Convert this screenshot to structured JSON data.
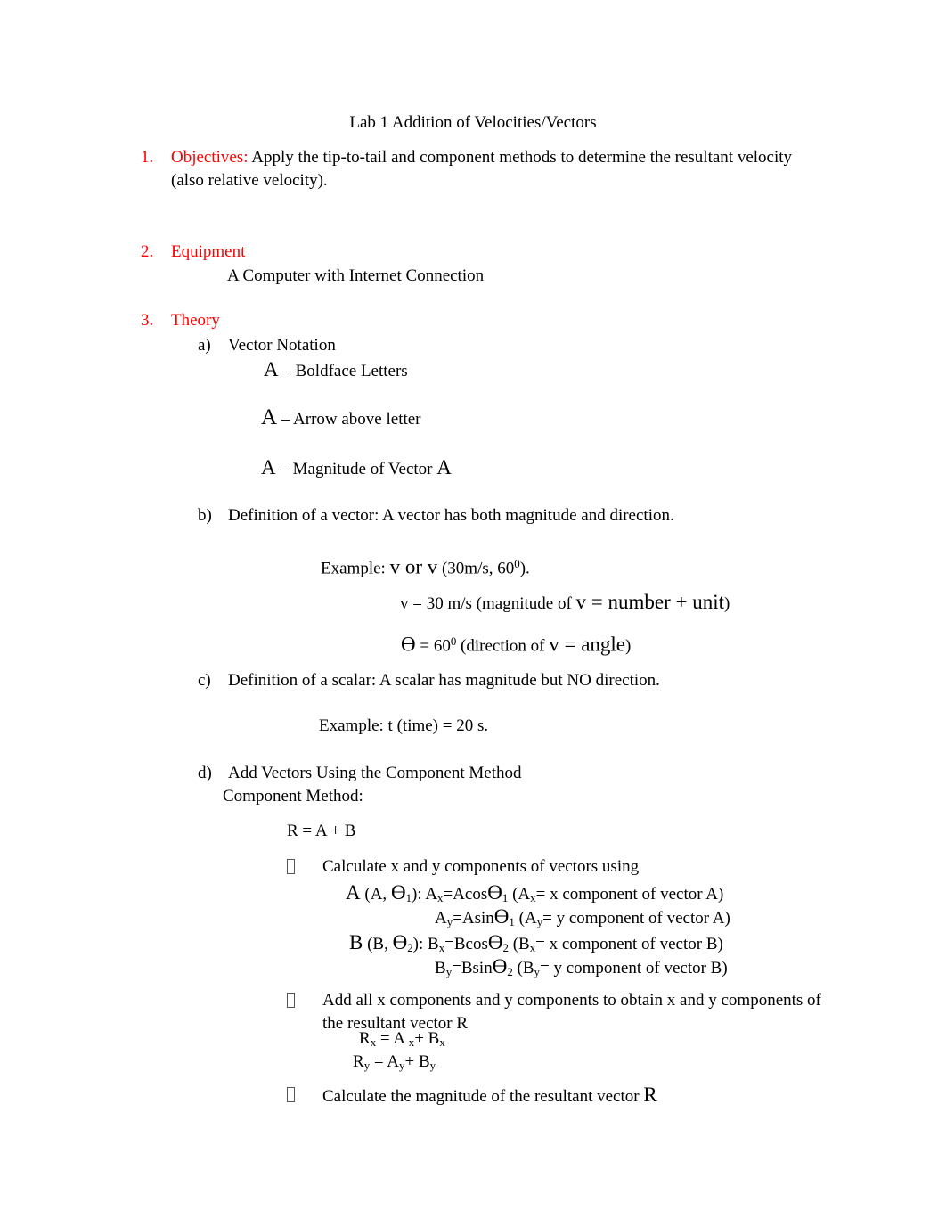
{
  "document": {
    "title": "Lab 1 Addition of Velocities/Vectors"
  },
  "colors": {
    "heading_red": "#FF0000",
    "body_text": "#000000",
    "page_background": "#FFFFFF"
  },
  "sections": [
    {
      "number": "1.",
      "heading": "Objectives:",
      "body": " Apply the tip-to-tail and component methods to determine the resultant velocity (also relative velocity)."
    },
    {
      "number": "2.",
      "heading": "Equipment",
      "body": "",
      "content_line": "A Computer with Internet Connection"
    },
    {
      "number": "3.",
      "heading": "Theory",
      "body": ""
    }
  ],
  "theory": {
    "items": [
      {
        "letter": "a)",
        "text": "Vector Notation"
      },
      {
        "letter": "b)",
        "text": "Definition of a vector:  A vector has both magnitude and direction."
      },
      {
        "letter": "c)",
        "text": "Definition of a scalar: A scalar has magnitude but NO direction."
      },
      {
        "letter": "d)",
        "text": "Add Vectors Using the Component Method"
      }
    ],
    "notation": {
      "line1_symbol": "A",
      "line1_text": " – Boldface Letters",
      "line2_symbol": "A",
      "line2_text": " – Arrow above letter",
      "line3_symbol": "A",
      "line3_text": " – Magnitude of Vector ",
      "line3_symbol_end": "A"
    },
    "vector_example": {
      "label": "Example:  ",
      "symbol_a": "v",
      "conjunction": " or ",
      "symbol_b": "v",
      "value": " (30m/s, 60",
      "value_sup": "0",
      "value_end": ")."
    },
    "magnitude_line": {
      "lead": "v = 30 m/s (magnitude of ",
      "emphasis": "v = number + unit",
      "tail": ")"
    },
    "direction_line": {
      "theta": "Ɵ",
      "lead": "  = 60",
      "sup": "0",
      "mid": "  (direction of ",
      "emphasis": "v = angle",
      "tail": ")"
    },
    "scalar_example": "Example: t (time) = 20 s.",
    "component_method_label": "Component Method:",
    "resultant_equation": "R = A + B"
  },
  "bullets": [
    {
      "glyph": "tofu-box",
      "text": "Calculate x and y components of vectors using"
    },
    {
      "glyph": "tofu-box",
      "text": "Add all x components and y components to obtain x and y components of the resultant vector R"
    },
    {
      "glyph": "tofu-box",
      "text": "Calculate the magnitude of the resultant vector ",
      "trailing_symbol": "R"
    }
  ],
  "equations": {
    "vector_a_line1": {
      "vec": "A",
      "args": " (A, ",
      "theta": "Ɵ",
      "sub": "1",
      "mid": "): A",
      "sub_x": "x",
      "eq": "=Acos",
      "theta2": "Ɵ",
      "sub2": "1",
      "paren": " (A",
      "sub_x2": "x",
      "desc": "= x component of vector A)"
    },
    "vector_a_line2": {
      "lead": "A",
      "sub_y": "y",
      "eq": "=Asin",
      "theta": "Ɵ",
      "sub": "1",
      "paren": "  (A",
      "sub_y2": "y",
      "desc": "= y component of vector A)"
    },
    "vector_b_line1": {
      "vec": "B",
      "args": " (B, ",
      "theta": "Ɵ",
      "sub": "2",
      "mid": "): B",
      "sub_x": "x",
      "eq": "=Bcos",
      "theta2": "Ɵ",
      "sub2": "2",
      "paren": " (B",
      "sub_x2": "x",
      "desc": "= x component of vector B)"
    },
    "vector_b_line2": {
      "lead": "B",
      "sub_y": "y",
      "eq": "=Bsin",
      "theta": "Ɵ",
      "sub": "2",
      "paren": "  (B",
      "sub_y2": "y",
      "desc": "= y component of vector B)"
    },
    "resultant_x": {
      "r": "R",
      "sub_r": "x",
      "eq": " = A ",
      "sub_a": "x",
      "plus": "+ B",
      "sub_b": "x"
    },
    "resultant_y": {
      "r": "R",
      "sub_r": "y",
      "eq": " = A",
      "sub_a": "y",
      "plus": "+ B",
      "sub_b": "y"
    }
  }
}
